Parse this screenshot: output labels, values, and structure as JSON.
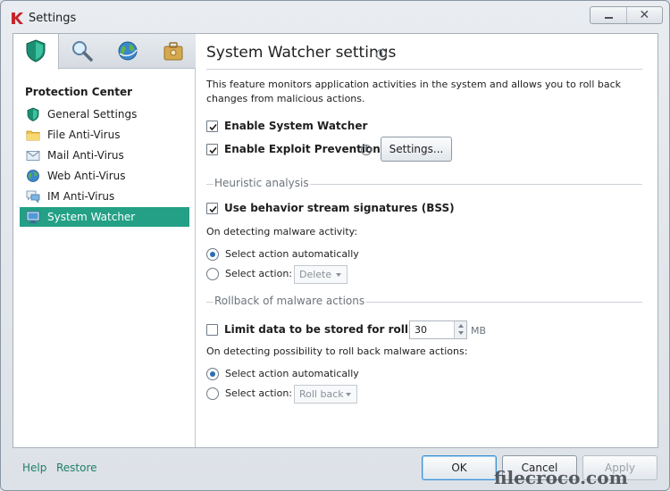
{
  "window": {
    "title": "Settings",
    "minimize_glyph": "minimize",
    "close_glyph": "✕"
  },
  "sidebar": {
    "tabs": [
      {
        "icon": "shield-icon",
        "active": true
      },
      {
        "icon": "magnifier-icon",
        "active": false
      },
      {
        "icon": "globe-icon",
        "active": false
      },
      {
        "icon": "toolbox-icon",
        "active": false
      }
    ],
    "heading": "Protection Center",
    "items": [
      {
        "label": "General Settings",
        "icon": "shield-icon"
      },
      {
        "label": "File Anti-Virus",
        "icon": "folder-icon"
      },
      {
        "label": "Mail Anti-Virus",
        "icon": "envelope-icon"
      },
      {
        "label": "Web Anti-Virus",
        "icon": "globe-icon"
      },
      {
        "label": "IM Anti-Virus",
        "icon": "chat-icon"
      },
      {
        "label": "System Watcher",
        "icon": "monitor-icon",
        "selected": true
      }
    ]
  },
  "main": {
    "title": "System Watcher settings",
    "description": "This feature monitors application activities in the system and allows you to roll back changes from malicious actions.",
    "enable_system_watcher": {
      "label": "Enable System Watcher",
      "checked": true
    },
    "enable_exploit_prevention": {
      "label": "Enable Exploit Prevention",
      "checked": true
    },
    "settings_button": "Settings...",
    "heuristic": {
      "section_title": "Heuristic analysis",
      "bss": {
        "label": "Use behavior stream signatures (BSS)",
        "checked": true
      },
      "on_detecting": "On detecting malware activity:",
      "auto_label": "Select action automatically",
      "manual_label": "Select action:",
      "dropdown_value": "Delete",
      "selected_option": "auto"
    },
    "rollback": {
      "section_title": "Rollback of malware actions",
      "limit": {
        "label": "Limit data to be stored for rollback:",
        "checked": false,
        "value": "30",
        "unit": "MB"
      },
      "on_detecting": "On detecting possibility to roll back malware actions:",
      "auto_label": "Select action automatically",
      "manual_label": "Select action:",
      "dropdown_value": "Roll back",
      "selected_option": "auto"
    }
  },
  "footer": {
    "help": "Help",
    "restore": "Restore",
    "ok": "OK",
    "cancel": "Cancel",
    "apply": "Apply"
  },
  "watermark": "filecroco.com",
  "colors": {
    "selection": "#23a086",
    "link": "#1e7e69",
    "radio_dot": "#2a6fb4"
  }
}
